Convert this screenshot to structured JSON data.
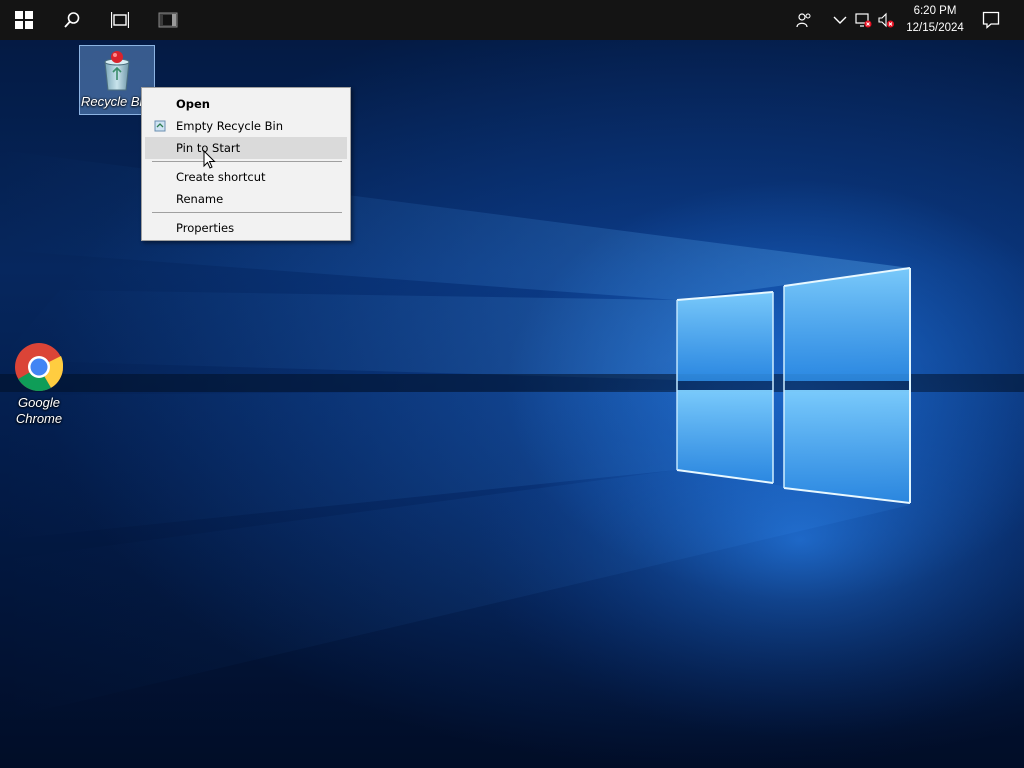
{
  "desktop": {
    "icons": [
      {
        "label": "Recycle Bin",
        "displayed_label": "Recycle Bi",
        "icon": "recycle-bin-icon",
        "selected": true
      },
      {
        "label": "Google Chrome",
        "line1": "Google",
        "line2": "Chrome",
        "icon": "chrome-icon"
      }
    ]
  },
  "context_menu": {
    "items": [
      {
        "label": "Open",
        "bold": true
      },
      {
        "label": "Empty Recycle Bin",
        "icon": "recycle-small-icon"
      },
      {
        "label": "Pin to Start",
        "highlighted": true
      },
      {
        "label": "Create shortcut"
      },
      {
        "label": "Rename"
      },
      {
        "label": "Properties"
      }
    ]
  },
  "taskbar": {
    "buttons": [
      "start-windows-icon",
      "search-icon",
      "task-view-icon",
      "app-thumbnail-icon"
    ],
    "tray": [
      "people-icon",
      "chevron-up-icon",
      "network-disconnected-icon",
      "volume-muted-icon",
      "action-center-icon"
    ],
    "clock": {
      "time": "6:20 PM",
      "date": "12/15/2024"
    }
  },
  "colors": {
    "taskbar": "#141414",
    "menu_background": "#f2f2f2",
    "menu_highlight": "#dadada",
    "selection": "#78aae6",
    "wallpaper_glow": "#2a8cff"
  }
}
